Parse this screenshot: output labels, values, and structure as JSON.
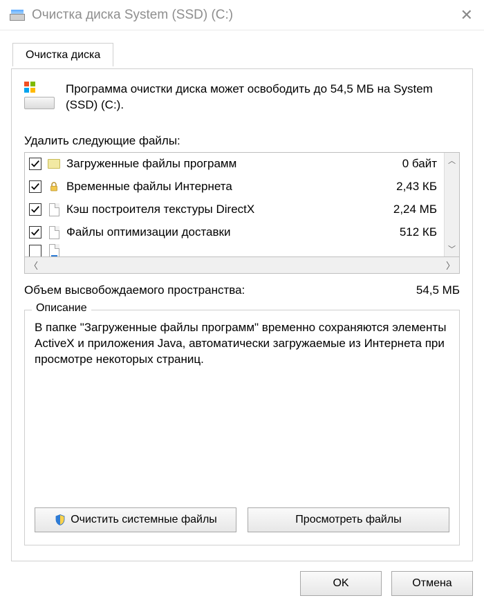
{
  "title": "Очистка диска System (SSD) (C:)",
  "tab_label": "Очистка диска",
  "intro": "Программа очистки диска может освободить до 54,5 МБ на System (SSD) (C:).",
  "list_label": "Удалить следующие файлы:",
  "files": [
    {
      "name": "Загруженные файлы программ",
      "size": "0 байт",
      "checked": true,
      "icon": "folder"
    },
    {
      "name": "Временные файлы Интернета",
      "size": "2,43 КБ",
      "checked": true,
      "icon": "lock"
    },
    {
      "name": "Кэш построителя текстуры DirectX",
      "size": "2,24 МБ",
      "checked": true,
      "icon": "file"
    },
    {
      "name": "Файлы оптимизации доставки",
      "size": "512 КБ",
      "checked": true,
      "icon": "file"
    }
  ],
  "freed_label": "Объем высвобождаемого пространства:",
  "freed_value": "54,5 МБ",
  "description_title": "Описание",
  "description_text": "В папке \"Загруженные файлы программ\" временно сохраняются элементы ActiveX и приложения Java, автоматически загружаемые из Интернета при просмотре некоторых страниц.",
  "buttons": {
    "clean_system": "Очистить системные файлы",
    "view_files": "Просмотреть файлы",
    "ok": "OK",
    "cancel": "Отмена"
  }
}
